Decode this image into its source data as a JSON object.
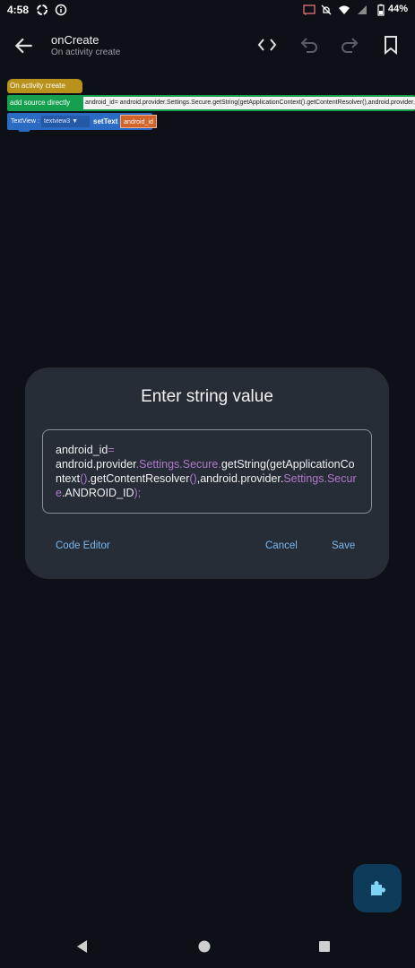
{
  "status_bar": {
    "time": "4:58",
    "battery": "44%"
  },
  "app_bar": {
    "title": "onCreate",
    "subtitle": "On activity create"
  },
  "blocks": {
    "event_label": "On activity create",
    "source_label": "add source directly",
    "source_code": "android_id= android.provider.Settings.Secure.getString(getApplicationContext().getContentResolver(),android.provider.Settings.Secure.ANDROID_ID);",
    "settext_type": "TextView :",
    "settext_target": "textview3",
    "settext_method": "setText",
    "settext_value": "android_id"
  },
  "dialog": {
    "title": "Enter string value",
    "code_line1_a": "android_id",
    "code_line1_b": "=",
    "code_line2_a": "android",
    "code_line2_b": ".provider",
    "code_line2_c": ".Settings.Secure.",
    "code_line2_d": "getString(getApplicati",
    "code_line3_a": "onContext",
    "code_line3_b": "()",
    "code_line3_c": ".getContentResolver",
    "code_line3_d": "()",
    "code_line3_e": ",android.provider.",
    "code_line3_f": "Setti",
    "code_line4_a": "ngs.Secure",
    "code_line4_b": ".ANDROID_ID",
    "code_line4_c": ");",
    "code_editor_label": "Code Editor",
    "cancel_label": "Cancel",
    "save_label": "Save"
  }
}
